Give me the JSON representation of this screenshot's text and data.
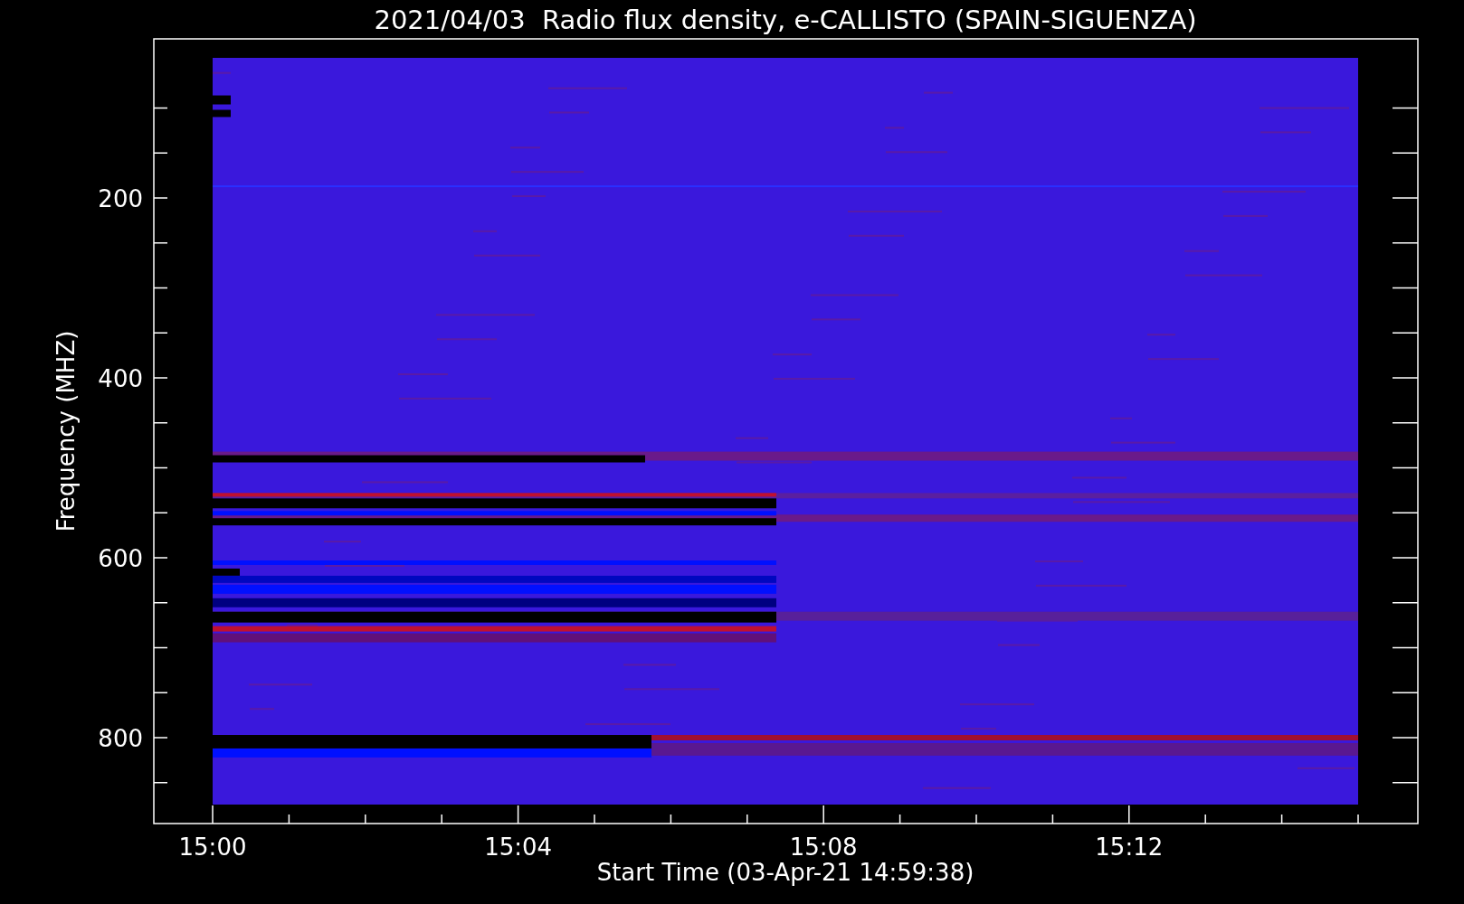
{
  "plot": {
    "title": "2021/04/03  Radio flux density, e-CALLISTO (SPAIN-SIGUENZA)",
    "ylabel": "Frequency (MHZ)",
    "y_tick_labels": [
      "200",
      "400",
      "600",
      "800"
    ],
    "x_tick_labels": [
      "15:00",
      "15:04",
      "15:08",
      "15:12"
    ],
    "xlabel": "Start Time (03-Apr-21 14:59:38)"
  }
}
